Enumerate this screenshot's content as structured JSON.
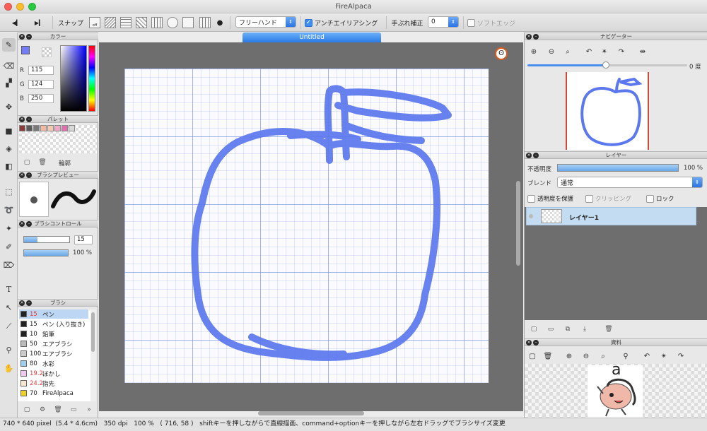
{
  "window": {
    "title": "FireAlpaca"
  },
  "toolbar": {
    "snap_label": "スナップ",
    "brush_mode": "フリーハンド",
    "antialias_label": "アンチエイリアシング",
    "antialias_checked": true,
    "stabilizer_label": "手ぶれ補正",
    "stabilizer_value": "0",
    "soft_edge_label": "ソフトエッジ"
  },
  "document": {
    "tab_title": "Untitled"
  },
  "color_panel": {
    "title": "カラー",
    "r_label": "R",
    "r_value": "115",
    "g_label": "G",
    "g_value": "124",
    "b_label": "B",
    "b_value": "250",
    "current_color": "#737cfa"
  },
  "palette_panel": {
    "title": "パレット",
    "swatches": [
      "#8b3a3a",
      "#5a5a5a",
      "#7a7a7a",
      "#f2b8a0",
      "#f5c9b0",
      "#f0a8c8",
      "#e070b0",
      "#d8d8d8"
    ],
    "outline_label": "輪郭"
  },
  "brush_preview_panel": {
    "title": "ブラシプレビュー"
  },
  "brush_control_panel": {
    "title": "ブラシコントロール",
    "size_value": "15",
    "opacity_value": "100 %"
  },
  "brush_panel": {
    "title": "ブラシ",
    "items": [
      {
        "size": "15",
        "name": "ペン",
        "color": "#222222",
        "size_color": "#e23d3d"
      },
      {
        "size": "15",
        "name": "ペン (入り抜き)",
        "color": "#222222",
        "size_color": "#222222"
      },
      {
        "size": "10",
        "name": "鉛筆",
        "color": "#222222",
        "size_color": "#222222"
      },
      {
        "size": "50",
        "name": "エアブラシ",
        "color": "#bbbbbb",
        "size_color": "#222222"
      },
      {
        "size": "100",
        "name": "エアブラシ",
        "color": "#cccccc",
        "size_color": "#222222"
      },
      {
        "size": "80",
        "name": "水彩",
        "color": "#9ad0f0",
        "size_color": "#222222"
      },
      {
        "size": "19.2",
        "name": "ぼかし",
        "color": "#f0c8f0",
        "size_color": "#e23d3d"
      },
      {
        "size": "24.2",
        "name": "指先",
        "color": "#f8e8d0",
        "size_color": "#e23d3d"
      },
      {
        "size": "70",
        "name": "FireAlpaca",
        "color": "#f0d020",
        "size_color": "#222222"
      }
    ]
  },
  "navigator_panel": {
    "title": "ナビゲーター",
    "rotation_value": "0 度"
  },
  "layer_panel": {
    "title": "レイヤー",
    "opacity_label": "不透明度",
    "opacity_value": "100 %",
    "blend_label": "ブレンド",
    "blend_value": "通常",
    "protect_alpha_label": "透明度を保護",
    "clipping_label": "クリッピング",
    "lock_label": "ロック",
    "layers": [
      {
        "name": "レイヤー1"
      }
    ]
  },
  "material_panel": {
    "title": "資料",
    "letter": "a"
  },
  "status": {
    "size_text": "740 * 640 pixel",
    "cm_text": "(5.4 * 4.6cm)",
    "dpi_text": "350 dpi",
    "zoom_text": "100 %",
    "coords_text": "( 716, 58 )",
    "hint_text": "shiftキーを押しながらで直線描画、command+optionキーを押しながら左右ドラッグでブラシサイズ変更"
  },
  "colors": {
    "accent": "#2a7be6",
    "stroke": "#5b78ee"
  }
}
